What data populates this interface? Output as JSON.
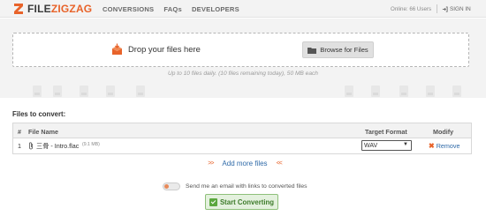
{
  "header": {
    "logo": {
      "prefix": "FILE",
      "suffix": "ZIGZAG"
    },
    "nav": [
      "CONVERSIONS",
      "FAQs",
      "DEVELOPERS"
    ],
    "online_label": "Online: 66 Users",
    "signin_label": "SIGN IN"
  },
  "upload": {
    "drop_label": "Drop your files here",
    "browse_label": "Browse for Files",
    "limit_note": "Up to 10 files daily. (10 files remaining today), 50 MB each"
  },
  "files": {
    "title": "Files to convert:",
    "columns": {
      "index": "#",
      "name": "File Name",
      "format": "Target Format",
      "modify": "Modify"
    },
    "rows": [
      {
        "index": "1",
        "name": "三骨 - Intro.flac",
        "size": "(9.1 MB)",
        "format": "WAV",
        "action": "Remove"
      }
    ]
  },
  "add_more": {
    "label": "Add more files",
    "left_arrows": ">>",
    "right_arrows": "<<"
  },
  "email_option": {
    "label": "Send me an email with links to converted files",
    "enabled": false
  },
  "start_button": {
    "label": "Start Converting"
  },
  "colors": {
    "brand": "#e8632a",
    "link": "#2f6aa8",
    "start_green": "#5aa83e"
  },
  "icons": [
    "filezigzag-logo-icon",
    "upload-box-icon",
    "folder-icon",
    "paperclip-icon",
    "remove-x-icon",
    "signin-icon",
    "check-icon"
  ]
}
